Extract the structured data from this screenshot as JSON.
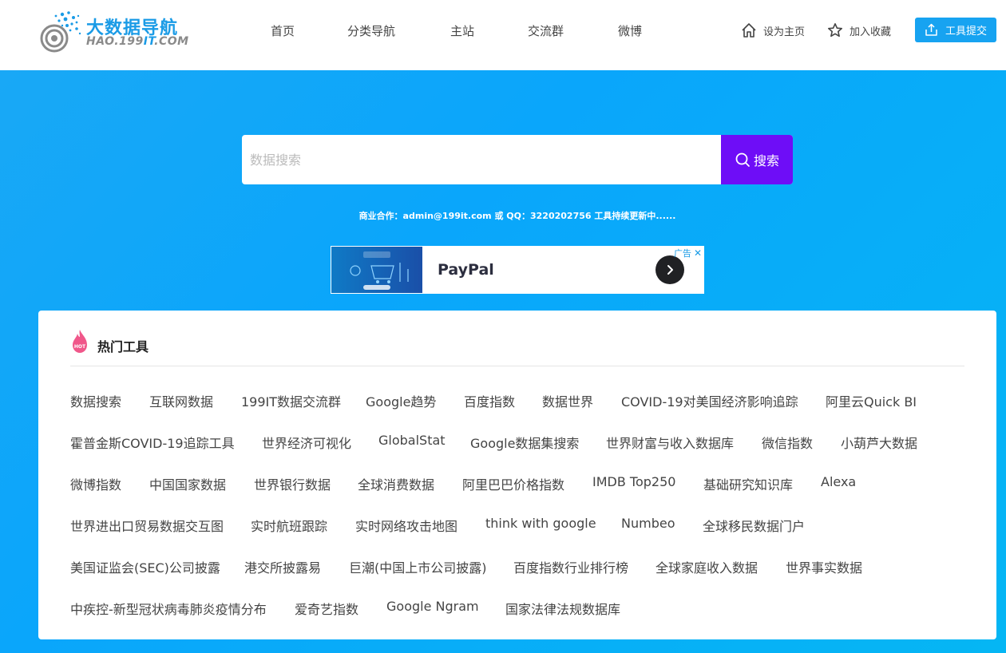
{
  "logo": {
    "title": "大数据导航",
    "subtitle_prefix": "HAO.199",
    "subtitle_highlight": "IT",
    "subtitle_suffix": ".COM"
  },
  "nav": [
    {
      "label": "首页"
    },
    {
      "label": "分类导航"
    },
    {
      "label": "主站"
    },
    {
      "label": "交流群"
    },
    {
      "label": "微博"
    }
  ],
  "header_links": {
    "set_home": "设为主页",
    "favorite": "加入收藏",
    "submit_tool": "工具提交"
  },
  "search": {
    "placeholder": "数据搜索",
    "value": "",
    "button_label": "搜索"
  },
  "contact_text": "商业合作：admin@199it.com 或 QQ：3220202756 工具持续更新中......",
  "ad": {
    "title": "PayPal",
    "badge": "广告",
    "close": "✕"
  },
  "hot_tools": {
    "title": "热门工具",
    "badge": "HOT",
    "rows": [
      [
        "数据搜索",
        "互联网数据",
        "199IT数据交流群",
        "Google趋势",
        "百度指数",
        "数据世界",
        "COVID-19对美国经济影响追踪",
        "阿里云Quick BI"
      ],
      [
        "霍普金斯COVID-19追踪工具",
        "世界经济可视化",
        "GlobalStat",
        "Google数据集搜索",
        "世界财富与收入数据库",
        "微信指数",
        "小葫芦大数据"
      ],
      [
        "微博指数",
        "中国国家数据",
        "世界银行数据",
        "全球消费数据",
        "阿里巴巴价格指数",
        "IMDB Top250",
        "基础研究知识库",
        "Alexa"
      ],
      [
        "世界进出口贸易数据交互图",
        "实时航班跟踪",
        "实时网络攻击地图",
        "think with google",
        "Numbeo",
        "全球移民数据门户"
      ],
      [
        "美国证监会(SEC)公司披露",
        "港交所披露易",
        "巨潮(中国上市公司披露)",
        "百度指数行业排行榜",
        "全球家庭收入数据",
        "世界事实数据"
      ],
      [
        "中疾控-新型冠状病毒肺炎疫情分布",
        "爱奇艺指数",
        "Google Ngram",
        "国家法律法规数据库"
      ]
    ]
  },
  "colors": {
    "accent": "#17a3f1",
    "search_button": "#6e0df7",
    "hot_icon": "#f0578a"
  }
}
